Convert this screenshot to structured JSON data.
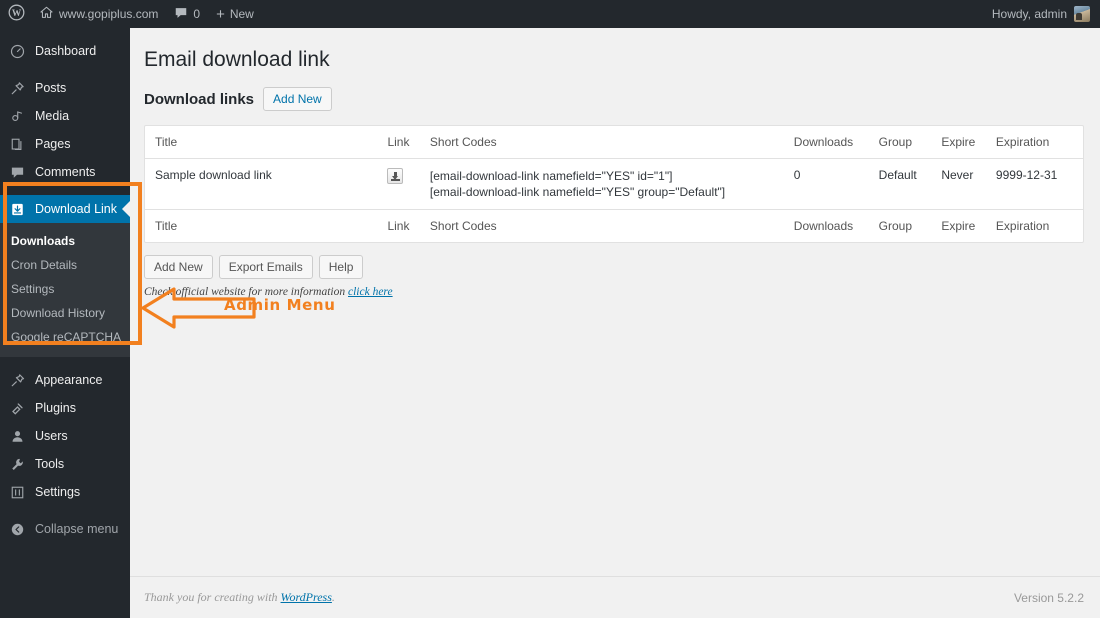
{
  "adminbar": {
    "logo_icon": "wordpress-logo-icon",
    "home_icon": "home-icon",
    "site_name": "www.gopiplus.com",
    "comments_icon": "comment-bubble-icon",
    "comment_count": "0",
    "new_icon": "plus-icon",
    "new_label": "New",
    "howdy": "Howdy, admin",
    "avatar_icon": "user-avatar"
  },
  "sidebar": {
    "items": [
      {
        "label": "Dashboard",
        "icon": "dashboard-gauge-icon"
      },
      {
        "label": "Posts",
        "icon": "pin-icon"
      },
      {
        "label": "Media",
        "icon": "media-icon"
      },
      {
        "label": "Pages",
        "icon": "pages-icon"
      },
      {
        "label": "Comments",
        "icon": "comment-bubble-icon"
      },
      {
        "label": "Download Link",
        "icon": "download-icon",
        "current": true
      },
      {
        "label": "Appearance",
        "icon": "brush-icon"
      },
      {
        "label": "Plugins",
        "icon": "plug-icon"
      },
      {
        "label": "Users",
        "icon": "user-icon"
      },
      {
        "label": "Tools",
        "icon": "wrench-icon"
      },
      {
        "label": "Settings",
        "icon": "sliders-icon"
      }
    ],
    "submenu": [
      {
        "label": "Downloads",
        "active": true
      },
      {
        "label": "Cron Details"
      },
      {
        "label": "Settings"
      },
      {
        "label": "Download History"
      },
      {
        "label": "Google reCAPTCHA"
      }
    ],
    "collapse": {
      "label": "Collapse menu",
      "icon": "collapse-arrow-icon"
    }
  },
  "annotation": {
    "label": "Admin Menu",
    "color": "#f2801f",
    "arrow_icon": "left-arrow-callout-icon"
  },
  "main": {
    "page_title": "Email download link",
    "subhead_title": "Download links",
    "add_new_top": "Add New",
    "table": {
      "columns": [
        "Title",
        "Link",
        "Short Codes",
        "Downloads",
        "Group",
        "Expire",
        "Expiration"
      ],
      "rows": [
        {
          "title": "Sample download link",
          "link_icon": "download-button-icon",
          "shortcodes": [
            "[email-download-link namefield=\"YES\" id=\"1\"]",
            "[email-download-link namefield=\"YES\" group=\"Default\"]"
          ],
          "downloads": "0",
          "group": "Default",
          "expire": "Never",
          "expiration": "9999-12-31"
        }
      ]
    },
    "buttons": [
      "Add New",
      "Export Emails",
      "Help"
    ],
    "note_text": "Check official website for more information ",
    "note_link": "click here"
  },
  "footer": {
    "thanks_prefix": "Thank you for creating with ",
    "thanks_link": "WordPress",
    "thanks_suffix": ".",
    "version": "Version 5.2.2"
  }
}
